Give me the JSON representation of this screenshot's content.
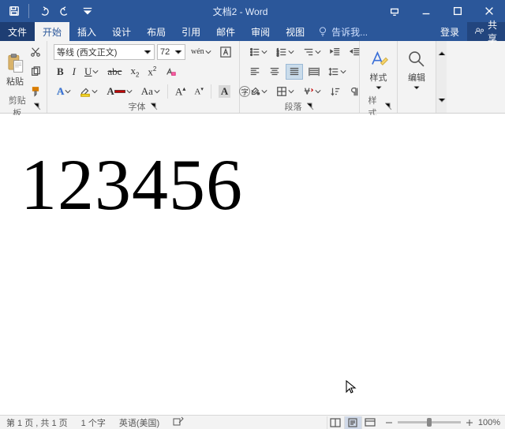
{
  "titlebar": {
    "title": "文档2 - Word"
  },
  "tabs": {
    "file": "文件",
    "items": [
      "开始",
      "插入",
      "设计",
      "布局",
      "引用",
      "邮件",
      "审阅",
      "视图"
    ],
    "active_index": 0,
    "tell_me": "告诉我...",
    "login": "登录",
    "share": "共享"
  },
  "ribbon": {
    "clipboard": {
      "label": "剪贴板",
      "paste": "粘贴"
    },
    "font": {
      "label": "字体",
      "name": "等线 (西文正文)",
      "size": "72"
    },
    "paragraph": {
      "label": "段落"
    },
    "styles": {
      "label": "样式",
      "button": "样式"
    },
    "editing": {
      "label": "",
      "button": "编辑"
    }
  },
  "document": {
    "text": "123456"
  },
  "status": {
    "page": "第 1 页 , 共 1 页",
    "words": "1 个字",
    "lang": "英语(美国)",
    "zoom": "100%"
  }
}
